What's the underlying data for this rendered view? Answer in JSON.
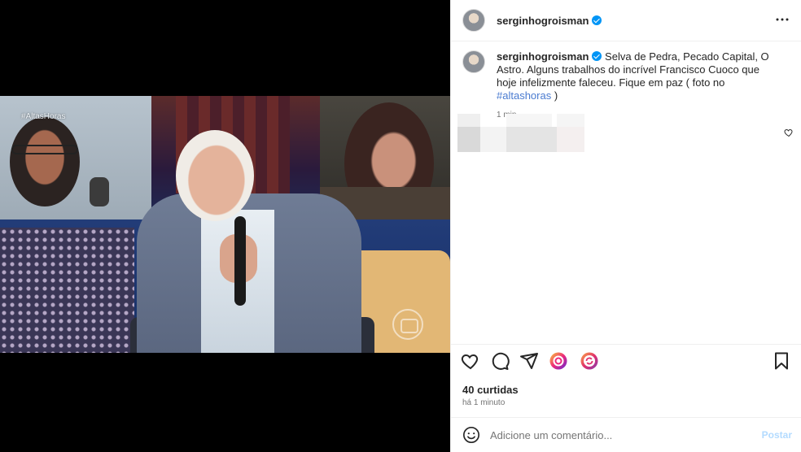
{
  "media": {
    "hashtag_overlay": "#AltasHoras"
  },
  "post": {
    "username": "serginhogroisman",
    "caption_text": "Selva de Pedra, Pecado Capital, O Astro. Alguns trabalhos do incrível Francisco Cuoco que hoje infelizmente faleceu. Fique em paz ( foto no ",
    "caption_hashtag": "#altashoras",
    "caption_end": " )",
    "caption_time": "1 min",
    "likes": "40 curtidas",
    "time_ago": "há 1 minuto"
  },
  "comment": {
    "placeholder": "Adicione um comentário...",
    "post_label": "Postar"
  },
  "icons": {
    "more": "more-options-icon",
    "like": "heart-icon",
    "comment": "comment-icon",
    "share": "share-icon",
    "save": "bookmark-icon",
    "emoji": "emoji-icon"
  },
  "colors": {
    "verified": "#0095f6",
    "hashtag": "#4a7bd0",
    "post_disabled": "#b3dbff",
    "muted": "#737373"
  }
}
